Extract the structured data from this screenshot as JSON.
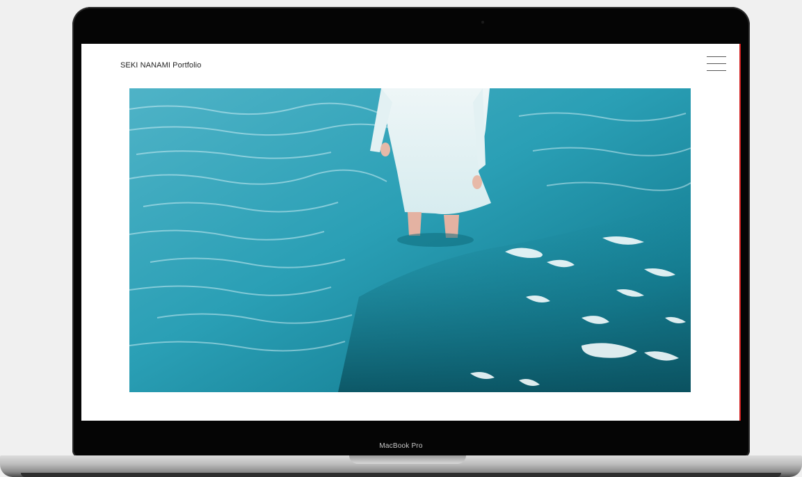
{
  "site": {
    "title": "SEKI NANAMI Portfolio"
  },
  "menu": {
    "icon": "hamburger-menu-icon"
  },
  "hero": {
    "image_description_icon": "photo-person-standing-in-sea"
  },
  "device": {
    "label": "MacBook Pro"
  },
  "colors": {
    "accent_edge": "#d41f1f",
    "sea": "#1f8fa4",
    "bezel": "#050505"
  }
}
